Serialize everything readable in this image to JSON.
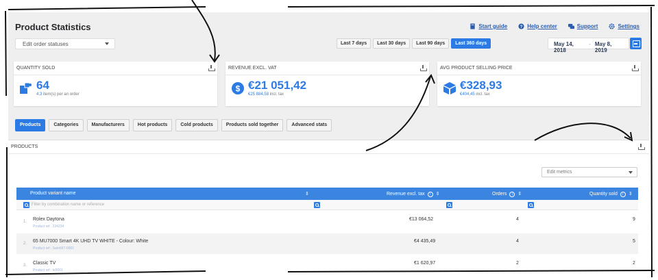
{
  "header": {
    "title": "Product Statistics",
    "links": [
      {
        "label": "Start guide",
        "icon": "book-icon"
      },
      {
        "label": "Help center",
        "icon": "help-circle-icon"
      },
      {
        "label": "Support",
        "icon": "support-chat-icon"
      },
      {
        "label": "Settings",
        "icon": "gear-icon"
      }
    ]
  },
  "filters": {
    "order_status": "Edit order statuses",
    "ranges": [
      "Last 7 days",
      "Last 30 days",
      "Last 90 days",
      "Last 360 days"
    ],
    "active_range": "Last 360 days",
    "date_from": "May 14, 2018",
    "date_sep": "-",
    "date_to": "May 8, 2019"
  },
  "kpis": [
    {
      "label": "QUANTITY SOLD",
      "value": "64",
      "sub_value": "4,3",
      "sub_text": "item(s) per an order",
      "icon": "boxes-icon"
    },
    {
      "label": "REVENUE EXCL. VAT",
      "value": "€21 051,42",
      "sub_value": "€25 884,58",
      "sub_text": "incl. tax",
      "icon": "dollar-coin-icon"
    },
    {
      "label": "AVG PRODUCT SELLING PRICE",
      "value": "€328,93",
      "sub_value": "€404,45",
      "sub_text": "incl. tax",
      "icon": "cube-icon"
    }
  ],
  "tabs": [
    "Products",
    "Categories",
    "Manufacturers",
    "Hot products",
    "Cold products",
    "Products sold together",
    "Advanced stats"
  ],
  "active_tab": "Products",
  "panel": {
    "title": "PRODUCTS",
    "metrics_placeholder": "Edit metrics",
    "columns": [
      "Product variant name",
      "Revenue excl. tax",
      "Orders",
      "Quantity sold"
    ],
    "filter_placeholder": "Filter by combination name or reference",
    "rows": [
      {
        "num": "1.",
        "name": "Rolex Daytona",
        "ref": "Product ref.: 234234",
        "revenue": "€13 064,52",
        "orders": "4",
        "qty": "9"
      },
      {
        "num": "2.",
        "name": "65 MU7000 Smart 4K UHD TV WHITE - Colour: White",
        "ref": "Product ref.: Sam007-0001",
        "revenue": "€4 435,49",
        "orders": "4",
        "qty": "5"
      },
      {
        "num": "3.",
        "name": "Classic TV",
        "ref": "Product ref.: tv0001",
        "revenue": "€1 620,97",
        "orders": "2",
        "qty": "2"
      }
    ]
  },
  "colors": {
    "accent": "#2c7be5",
    "header_bg": "#3b84e0",
    "page_bg": "#efefef"
  }
}
